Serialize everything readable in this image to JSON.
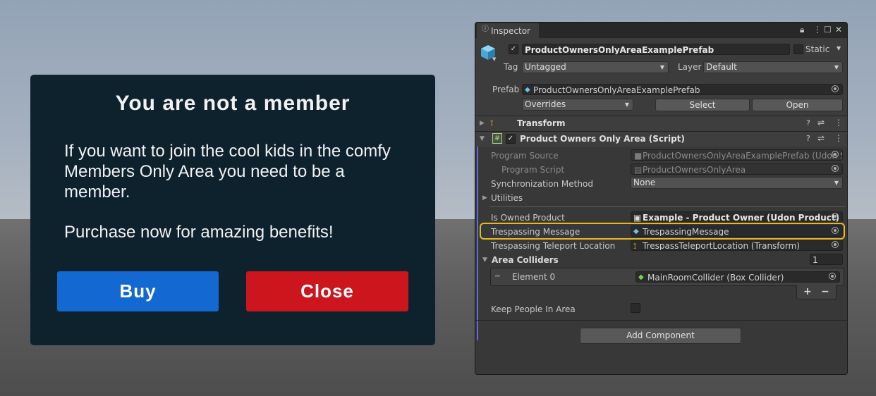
{
  "popup": {
    "title": "You are not a member",
    "body1": "If you want to join the cool kids in the comfy Members Only Area you need to be a member.",
    "body2": "Purchase now for amazing benefits!",
    "buy_label": "Buy",
    "close_label": "Close",
    "colors": {
      "background": "#0e222d",
      "buy": "#1368d1",
      "close": "#cc151d"
    }
  },
  "inspector": {
    "tab_label": "Inspector",
    "object": {
      "active": true,
      "name": "ProductOwnersOnlyAreaExamplePrefab",
      "static_label": "Static",
      "tag_label": "Tag",
      "tag_value": "Untagged",
      "layer_label": "Layer",
      "layer_value": "Default",
      "prefab_label": "Prefab",
      "prefab_value": "ProductOwnersOnlyAreaExamplePrefab",
      "overrides_label": "Overrides",
      "select_label": "Select",
      "open_label": "Open"
    },
    "transform": {
      "title": "Transform"
    },
    "script": {
      "title": "Product Owners Only Area (Script)",
      "program_source_label": "Program Source",
      "program_source_value": "ProductOwnersOnlyAreaExamplePrefab (Udon S",
      "program_script_label": "Program Script",
      "program_script_value": "ProductOwnersOnlyArea",
      "sync_label": "Synchronization Method",
      "sync_value": "None",
      "utilities_label": "Utilities",
      "owned_product_label": "Is Owned Product",
      "owned_product_value": "Example - Product Owner (Udon Product)",
      "trespassing_message_label": "Trespassing Message",
      "trespassing_message_value": "TrespassingMessage",
      "teleport_label": "Trespassing Teleport Location",
      "teleport_value": "TrespassTeleportLocation (Transform)",
      "area_colliders_label": "Area Colliders",
      "area_colliders_count": "1",
      "element0_label": "Element 0",
      "element0_value": "MainRoomCollider (Box Collider)",
      "add_label": "+",
      "remove_label": "−",
      "keep_people_label": "Keep People In Area",
      "keep_people_checked": false
    },
    "add_component_label": "Add Component",
    "highlight_color": "#e8b823"
  }
}
